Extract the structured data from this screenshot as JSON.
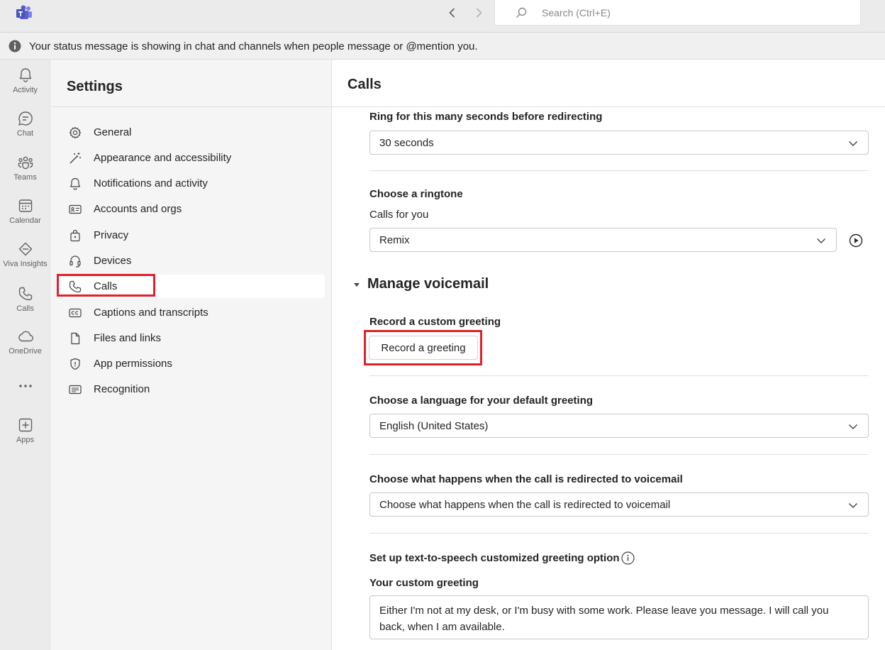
{
  "titlebar": {
    "app_icon": "teams-logo-icon",
    "search_placeholder": "Search (Ctrl+E)"
  },
  "banner": {
    "icon": "info-icon",
    "text": "Your status message is showing in chat and channels when people message or @mention you."
  },
  "rail": {
    "items": [
      {
        "label": "Activity",
        "icon": "bell-icon"
      },
      {
        "label": "Chat",
        "icon": "chat-icon"
      },
      {
        "label": "Teams",
        "icon": "teams-icon"
      },
      {
        "label": "Calendar",
        "icon": "calendar-icon"
      },
      {
        "label": "Viva Insights",
        "icon": "viva-insights-icon"
      },
      {
        "label": "Calls",
        "icon": "phone-icon"
      },
      {
        "label": "OneDrive",
        "icon": "cloud-icon"
      },
      {
        "label": "",
        "icon": "more-icon"
      },
      {
        "label": "Apps",
        "icon": "add-apps-icon"
      }
    ]
  },
  "settings": {
    "title": "Settings",
    "menu": [
      {
        "label": "General",
        "icon": "gear-icon",
        "selected": false
      },
      {
        "label": "Appearance and accessibility",
        "icon": "magic-wand-icon",
        "selected": false
      },
      {
        "label": "Notifications and activity",
        "icon": "bell-icon",
        "selected": false
      },
      {
        "label": "Accounts and orgs",
        "icon": "id-card-icon",
        "selected": false
      },
      {
        "label": "Privacy",
        "icon": "lock-icon",
        "selected": false
      },
      {
        "label": "Devices",
        "icon": "headset-icon",
        "selected": false
      },
      {
        "label": "Calls",
        "icon": "phone-icon",
        "selected": true
      },
      {
        "label": "Captions and transcripts",
        "icon": "closed-captions-icon",
        "selected": false
      },
      {
        "label": "Files and links",
        "icon": "document-icon",
        "selected": false
      },
      {
        "label": "App permissions",
        "icon": "shield-icon",
        "selected": false
      },
      {
        "label": "Recognition",
        "icon": "text-lines-icon",
        "selected": false
      }
    ]
  },
  "main": {
    "title": "Calls",
    "ring_label": "Ring for this many seconds before redirecting",
    "ring_value": "30 seconds",
    "ringtone_label": "Choose a ringtone",
    "ringtone_sub": "Calls for you",
    "ringtone_value": "Remix",
    "voicemail_heading": "Manage voicemail",
    "greeting_label": "Record a custom greeting",
    "greeting_button": "Record a greeting",
    "language_label": "Choose a language for your default greeting",
    "language_value": "English (United States)",
    "redirect_label": "Choose what happens when the call is redirected to voicemail",
    "redirect_value": "Choose what happens when the call is redirected to voicemail",
    "tts_label": "Set up text-to-speech customized greeting option",
    "custom_greeting_label": "Your custom greeting",
    "custom_greeting_value": "Either I'm not at my desk, or I'm busy with some work. Please leave you message. I will call you back, when I am available."
  },
  "colors": {
    "highlight": "#e0202a",
    "teams_purple": "#5b5fc7"
  }
}
